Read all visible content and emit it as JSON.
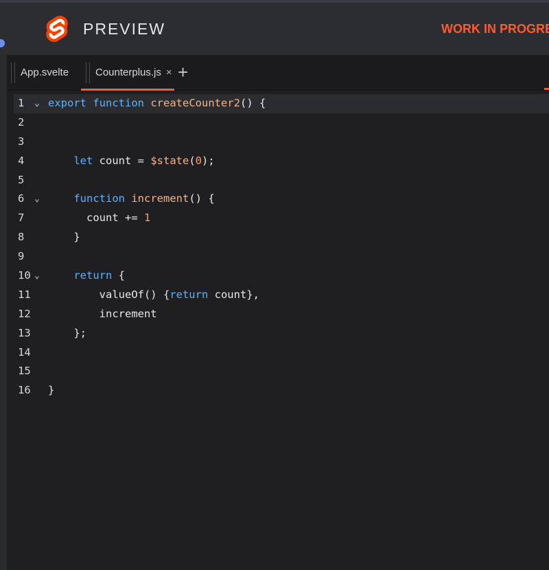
{
  "header": {
    "brand": "PREVIEW",
    "notice": "WORK IN PROGRESS",
    "colors": {
      "accent": "#ff3e00",
      "notice": "#ff5a2c"
    }
  },
  "tabs": [
    {
      "label": "App.svelte",
      "active": false
    },
    {
      "label": "Counterplus.js",
      "active": true,
      "close": "×"
    }
  ],
  "add_tab_label": "+",
  "editor": {
    "current_line": 1,
    "lines": [
      {
        "n": "1",
        "fold": true,
        "tokens": [
          {
            "t": "export",
            "c": "kw"
          },
          {
            "t": " "
          },
          {
            "t": "function",
            "c": "kw"
          },
          {
            "t": " "
          },
          {
            "t": "createCounter2",
            "c": "fn"
          },
          {
            "t": "() {"
          }
        ]
      },
      {
        "n": "2",
        "fold": false,
        "tokens": []
      },
      {
        "n": "3",
        "fold": false,
        "tokens": []
      },
      {
        "n": "4",
        "fold": false,
        "tokens": [
          {
            "t": "    "
          },
          {
            "t": "let",
            "c": "kw"
          },
          {
            "t": " count = "
          },
          {
            "t": "$state",
            "c": "fn"
          },
          {
            "t": "("
          },
          {
            "t": "0",
            "c": "num"
          },
          {
            "t": ");"
          }
        ]
      },
      {
        "n": "5",
        "fold": false,
        "tokens": []
      },
      {
        "n": "6",
        "fold": true,
        "tokens": [
          {
            "t": "    "
          },
          {
            "t": "function",
            "c": "kw"
          },
          {
            "t": " "
          },
          {
            "t": "increment",
            "c": "fn"
          },
          {
            "t": "() {"
          }
        ]
      },
      {
        "n": "7",
        "fold": false,
        "tokens": [
          {
            "t": "      count += "
          },
          {
            "t": "1",
            "c": "num"
          }
        ]
      },
      {
        "n": "8",
        "fold": false,
        "tokens": [
          {
            "t": "    }"
          }
        ]
      },
      {
        "n": "9",
        "fold": false,
        "tokens": []
      },
      {
        "n": "10",
        "fold": true,
        "tokens": [
          {
            "t": "    "
          },
          {
            "t": "return",
            "c": "kw"
          },
          {
            "t": " {"
          }
        ]
      },
      {
        "n": "11",
        "fold": false,
        "tokens": [
          {
            "t": "        valueOf() {"
          },
          {
            "t": "return",
            "c": "kw"
          },
          {
            "t": " count},"
          }
        ]
      },
      {
        "n": "12",
        "fold": false,
        "tokens": [
          {
            "t": "        increment"
          }
        ]
      },
      {
        "n": "13",
        "fold": false,
        "tokens": [
          {
            "t": "    };"
          }
        ]
      },
      {
        "n": "14",
        "fold": false,
        "tokens": []
      },
      {
        "n": "15",
        "fold": false,
        "tokens": []
      },
      {
        "n": "16",
        "fold": false,
        "tokens": [
          {
            "t": "}"
          }
        ]
      }
    ]
  }
}
